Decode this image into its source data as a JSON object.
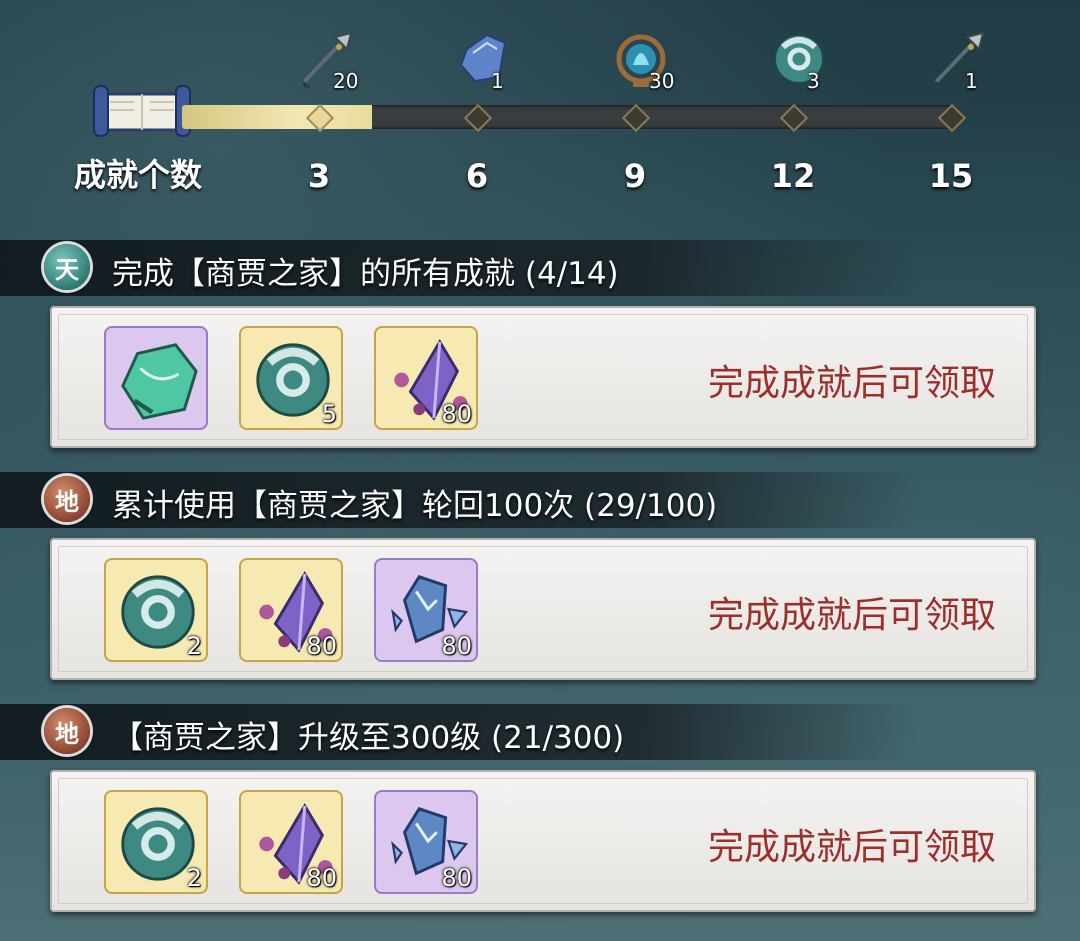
{
  "progress": {
    "label": "成就个数",
    "current": 4,
    "max": 15,
    "milestones": [
      {
        "value": "3",
        "reward_icon": "spear-icon",
        "reward_count": "20",
        "reached": true
      },
      {
        "value": "6",
        "reward_icon": "blue-crystal-icon",
        "reward_count": "1",
        "reached": false
      },
      {
        "value": "9",
        "reward_icon": "spirit-flame-mirror-icon",
        "reward_count": "30",
        "reached": false
      },
      {
        "value": "12",
        "reward_icon": "jade-ring-icon",
        "reward_count": "3",
        "reached": false
      },
      {
        "value": "15",
        "reward_icon": "spear-icon",
        "reward_count": "1",
        "reached": false
      }
    ]
  },
  "achievements": [
    {
      "grade": "天",
      "grade_color": "#2f7b74",
      "title": "完成【商贾之家】的所有成就 (4/14)",
      "status": "完成成就后可领取",
      "rewards": [
        {
          "icon": "green-crystal-icon",
          "rarity": "purple",
          "qty": ""
        },
        {
          "icon": "jade-ring-icon",
          "rarity": "gold",
          "qty": "5"
        },
        {
          "icon": "purple-gem-icon",
          "rarity": "gold",
          "qty": "80"
        }
      ]
    },
    {
      "grade": "地",
      "grade_color": "#8e4430",
      "title": "累计使用【商贾之家】轮回100次 (29/100)",
      "status": "完成成就后可领取",
      "rewards": [
        {
          "icon": "jade-ring-icon",
          "rarity": "gold",
          "qty": "2"
        },
        {
          "icon": "purple-gem-icon",
          "rarity": "gold",
          "qty": "80"
        },
        {
          "icon": "ice-shard-icon",
          "rarity": "purple",
          "qty": "80"
        }
      ]
    },
    {
      "grade": "地",
      "grade_color": "#8e4430",
      "title": "【商贾之家】升级至300级 (21/300)",
      "status": "完成成就后可领取",
      "rewards": [
        {
          "icon": "jade-ring-icon",
          "rarity": "gold",
          "qty": "2"
        },
        {
          "icon": "purple-gem-icon",
          "rarity": "gold",
          "qty": "80"
        },
        {
          "icon": "ice-shard-icon",
          "rarity": "purple",
          "qty": "80"
        }
      ]
    }
  ]
}
